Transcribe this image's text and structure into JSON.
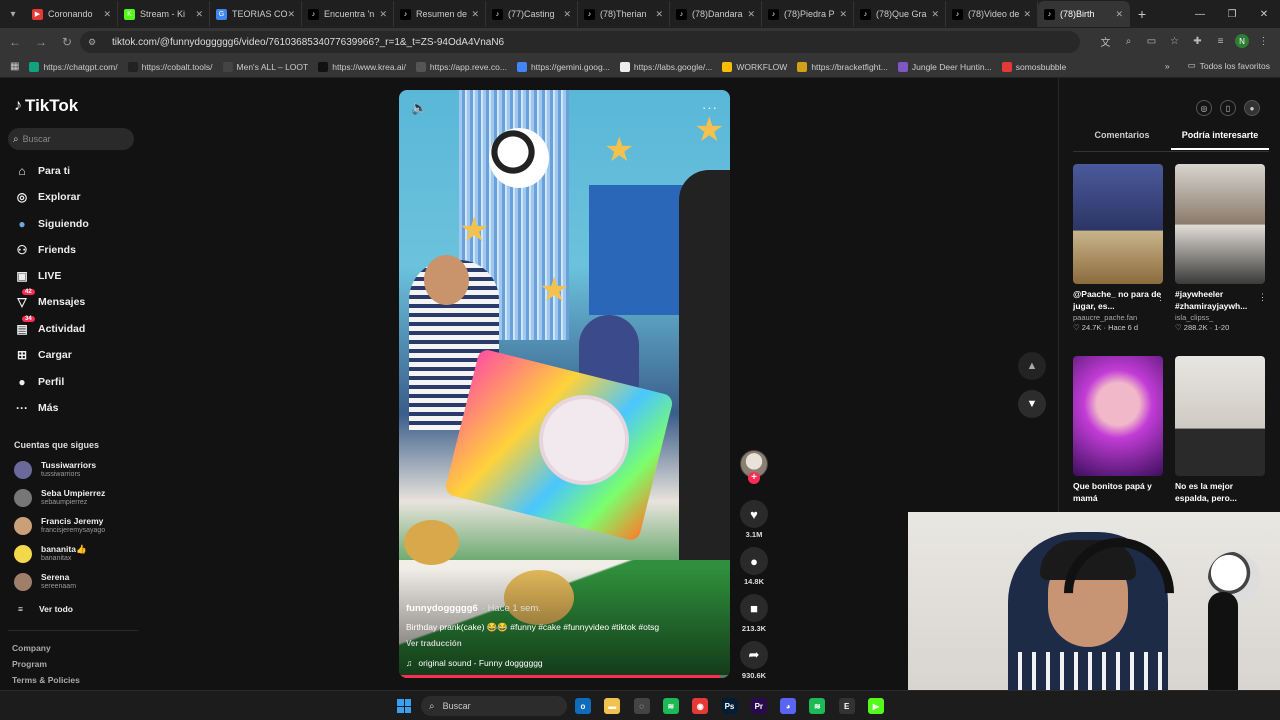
{
  "browser": {
    "tabs": [
      {
        "title": "Coronando",
        "color": "#e53935",
        "glyph": "▶"
      },
      {
        "title": "Stream - Ki",
        "color": "#53fc18",
        "glyph": "K"
      },
      {
        "title": "TEORIAS CO",
        "color": "#4285f4",
        "glyph": "G"
      },
      {
        "title": "Encuentra 'n",
        "color": "#000000",
        "glyph": "♪"
      },
      {
        "title": "Resumen de",
        "color": "#000000",
        "glyph": "♪"
      },
      {
        "title": "(77)Casting",
        "color": "#000000",
        "glyph": "♪"
      },
      {
        "title": "(78)Therian",
        "color": "#000000",
        "glyph": "♪"
      },
      {
        "title": "(78)Dandara",
        "color": "#000000",
        "glyph": "♪"
      },
      {
        "title": "(78)Piedra P",
        "color": "#000000",
        "glyph": "♪"
      },
      {
        "title": "(78)Que Gra",
        "color": "#000000",
        "glyph": "♪"
      },
      {
        "title": "(78)Video de",
        "color": "#000000",
        "glyph": "♪"
      },
      {
        "title": "(78)Birth",
        "color": "#000000",
        "glyph": "♪"
      }
    ],
    "url": "tiktok.com/@funnydoggggg6/video/7610368534077639966?_r=1&_t=ZS-94OdA4VnaN6",
    "avatar_letter": "N",
    "bookmarks": [
      {
        "label": "https://chatgpt.com/",
        "color": "#10a37f"
      },
      {
        "label": "https://cobalt.tools/",
        "color": "#222222"
      },
      {
        "label": "Men's ALL – LOOT",
        "color": "#444444"
      },
      {
        "label": "https://www.krea.ai/",
        "color": "#111111"
      },
      {
        "label": "https://app.reve.co...",
        "color": "#555555"
      },
      {
        "label": "https://gemini.goog...",
        "color": "#4285f4"
      },
      {
        "label": "https://labs.google/...",
        "color": "#eeeeee"
      },
      {
        "label": "WORKFLOW",
        "color": "#fbbc04"
      },
      {
        "label": "https://bracketfight...",
        "color": "#d4a017"
      },
      {
        "label": "Jungle Deer Huntin...",
        "color": "#7e57c2"
      },
      {
        "label": "somosbubble",
        "color": "#e53935"
      }
    ],
    "all_bookmarks": "Todos los favoritos"
  },
  "sidebar": {
    "brand": "TikTok",
    "search_placeholder": "Buscar",
    "nav": [
      {
        "label": "Para ti",
        "icon": "home-icon",
        "glyph": "⌂"
      },
      {
        "label": "Explorar",
        "icon": "compass-icon",
        "glyph": "◎"
      },
      {
        "label": "Siguiendo",
        "icon": "following-avatar-icon",
        "glyph": "●"
      },
      {
        "label": "Friends",
        "icon": "friends-icon",
        "glyph": "⚇"
      },
      {
        "label": "LIVE",
        "icon": "live-icon",
        "glyph": "▣"
      },
      {
        "label": "Mensajes",
        "icon": "messages-icon",
        "glyph": "▽",
        "badge": "42"
      },
      {
        "label": "Actividad",
        "icon": "activity-icon",
        "glyph": "▤",
        "badge": "34"
      },
      {
        "label": "Cargar",
        "icon": "upload-icon",
        "glyph": "⊞"
      },
      {
        "label": "Perfil",
        "icon": "profile-icon",
        "glyph": "●"
      },
      {
        "label": "Más",
        "icon": "more-icon",
        "glyph": "···"
      }
    ],
    "following_header": "Cuentas que sigues",
    "following": [
      {
        "name": "Tussiwarriors",
        "user": "tussiwarriors",
        "color": "#6a6a9a"
      },
      {
        "name": "Seba Umpierrez",
        "user": "sebaumpierrez",
        "color": "#777777"
      },
      {
        "name": "Francis Jeremy",
        "user": "francisjeremysayago",
        "color": "#c9a07a"
      },
      {
        "name": "bananita👍",
        "user": "bananitax",
        "color": "#f2d84a"
      },
      {
        "name": "Serena",
        "user": "sereenaam",
        "color": "#a07f6a"
      }
    ],
    "see_all": "Ver todo",
    "footer": [
      "Company",
      "Program",
      "Terms & Policies"
    ]
  },
  "video": {
    "author": "funnydoggggg6",
    "time_ago": "· Hace 1 sem.",
    "description": "Birthday prank(cake) 😂😂 #funny #cake #funnyvideo #tiktok #otsg",
    "see_translation": "Ver traducción",
    "sound": "original sound - Funny dogggggg",
    "progress_pct": 97
  },
  "actions": [
    {
      "name": "like",
      "glyph": "♥",
      "count": "3.1M"
    },
    {
      "name": "comment",
      "glyph": "●",
      "count": "14.8K"
    },
    {
      "name": "save",
      "glyph": "■",
      "count": "213.3K"
    },
    {
      "name": "share",
      "glyph": "➦",
      "count": "930.6K"
    }
  ],
  "right_panel": {
    "tabs": [
      "Comentarios",
      "Podría interesarte"
    ],
    "active_tab": 1,
    "cards": [
      {
        "title": "@Paache_ no para de jugar, es...",
        "user": "paaucre_pache.fan",
        "stats": "♡ 24.7K · Hace 6 d",
        "bg": "linear-gradient(180deg,#4a5a9a,#2d3566 55%,#c8b48a 56%,#8c6b3c)"
      },
      {
        "title": "#jaywheeler #zhamirayjaywh...",
        "user": "isla_clipss_",
        "stats": "♡ 288.2K · 1-20",
        "bg": "linear-gradient(180deg,#d8d4ce,#8b7b6c 50%,#e0dcd6 51%,#3a3a3a)"
      },
      {
        "title": "Que bonitos papá y mamá",
        "user": "",
        "stats": "",
        "bg": "radial-gradient(circle at 50% 40%,#f0b8c8 0 25%,#c23cd6 40%,#3a0f5c)"
      },
      {
        "title": "No es la mejor espalda, pero...",
        "user": "",
        "stats": "",
        "bg": "linear-gradient(180deg,#e8e6e2,#cfcac2 60%,#2a2a2a 61%)"
      }
    ]
  },
  "taskbar": {
    "search": "Buscar",
    "apps": [
      {
        "name": "outlook",
        "color": "#0f6cbd",
        "glyph": "o"
      },
      {
        "name": "file-explorer",
        "color": "#f2c14e",
        "glyph": "▬"
      },
      {
        "name": "steam-activity",
        "color": "#444444",
        "glyph": "◌"
      },
      {
        "name": "spotify",
        "color": "#1db954",
        "glyph": "≋"
      },
      {
        "name": "chrome",
        "color": "#e53935",
        "glyph": "◉"
      },
      {
        "name": "photoshop",
        "color": "#001e36",
        "glyph": "Ps"
      },
      {
        "name": "premiere",
        "color": "#2a0a4a",
        "glyph": "Pr"
      },
      {
        "name": "discord",
        "color": "#5865f2",
        "glyph": "◕"
      },
      {
        "name": "spotify-2",
        "color": "#1db954",
        "glyph": "≋"
      },
      {
        "name": "epic-games",
        "color": "#333333",
        "glyph": "E"
      },
      {
        "name": "kick",
        "color": "#53fc18",
        "glyph": "▶"
      }
    ]
  }
}
